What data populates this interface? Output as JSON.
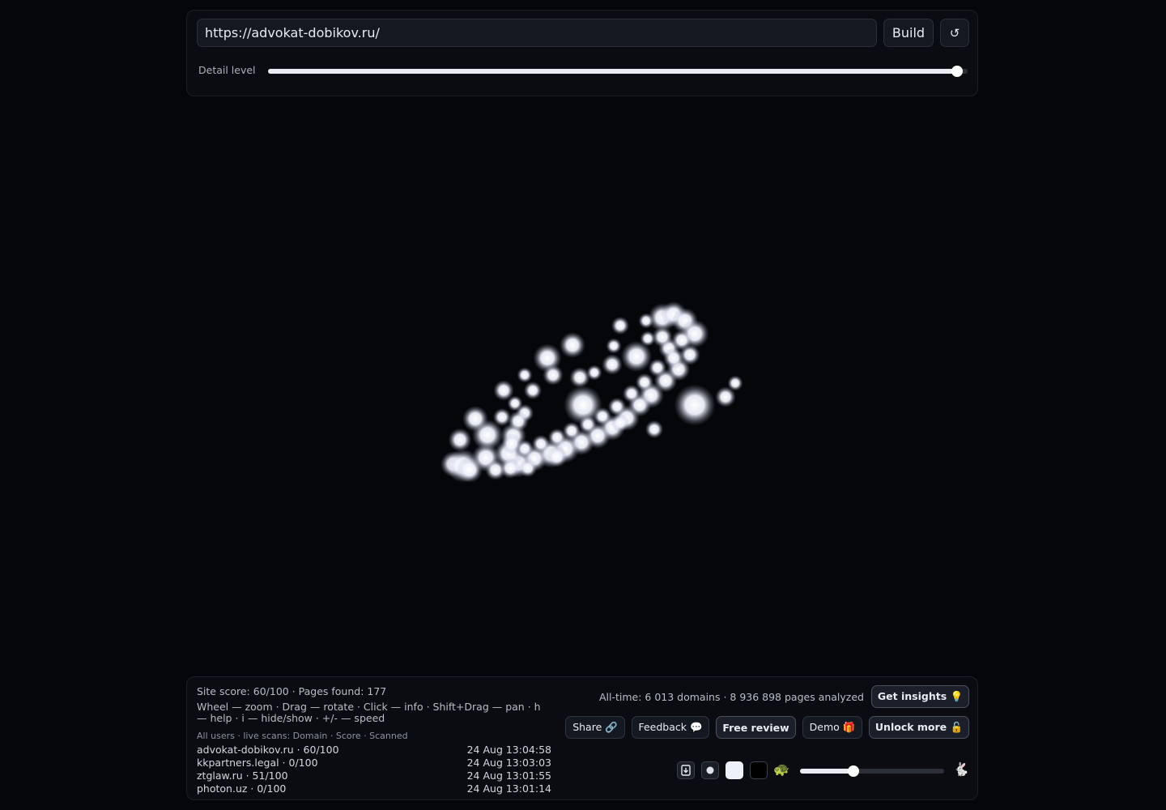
{
  "top": {
    "url_value": "https://advokat-dobikov.ru/",
    "build_label": "Build",
    "reload_glyph": "↺",
    "detail_label": "Detail level",
    "detail_level": 0.985
  },
  "bottom": {
    "site_stats": "Site score: 60/100 · Pages found: 177",
    "help_text": "Wheel — zoom · Drag — rotate · Click — info · Shift+Drag — pan · h — help · i — hide/show · +/- — speed",
    "live_title": "All users · live scans: Domain · Score · Scanned",
    "scans": [
      {
        "domain": "advokat-dobikov.ru · 60/100",
        "time": "24 Aug 13:04:58"
      },
      {
        "domain": "kkpartners.legal · 0/100",
        "time": "24 Aug 13:03:03"
      },
      {
        "domain": "ztglaw.ru · 51/100",
        "time": "24 Aug 13:01:55"
      },
      {
        "domain": "photon.uz · 0/100",
        "time": "24 Aug 13:01:14"
      }
    ],
    "alltime": "All-time: 6 013 domains · 8 936 898 pages analyzed",
    "get_insights": "Get insights 💡",
    "share": "Share 🔗",
    "feedback": "Feedback 💬",
    "free_review": "Free review",
    "demo": "Demo 🎁",
    "unlock_more": "Unlock more 🔓",
    "speed_level": 0.37,
    "slow_icon": "🐢",
    "fast_icon": "🐇"
  }
}
